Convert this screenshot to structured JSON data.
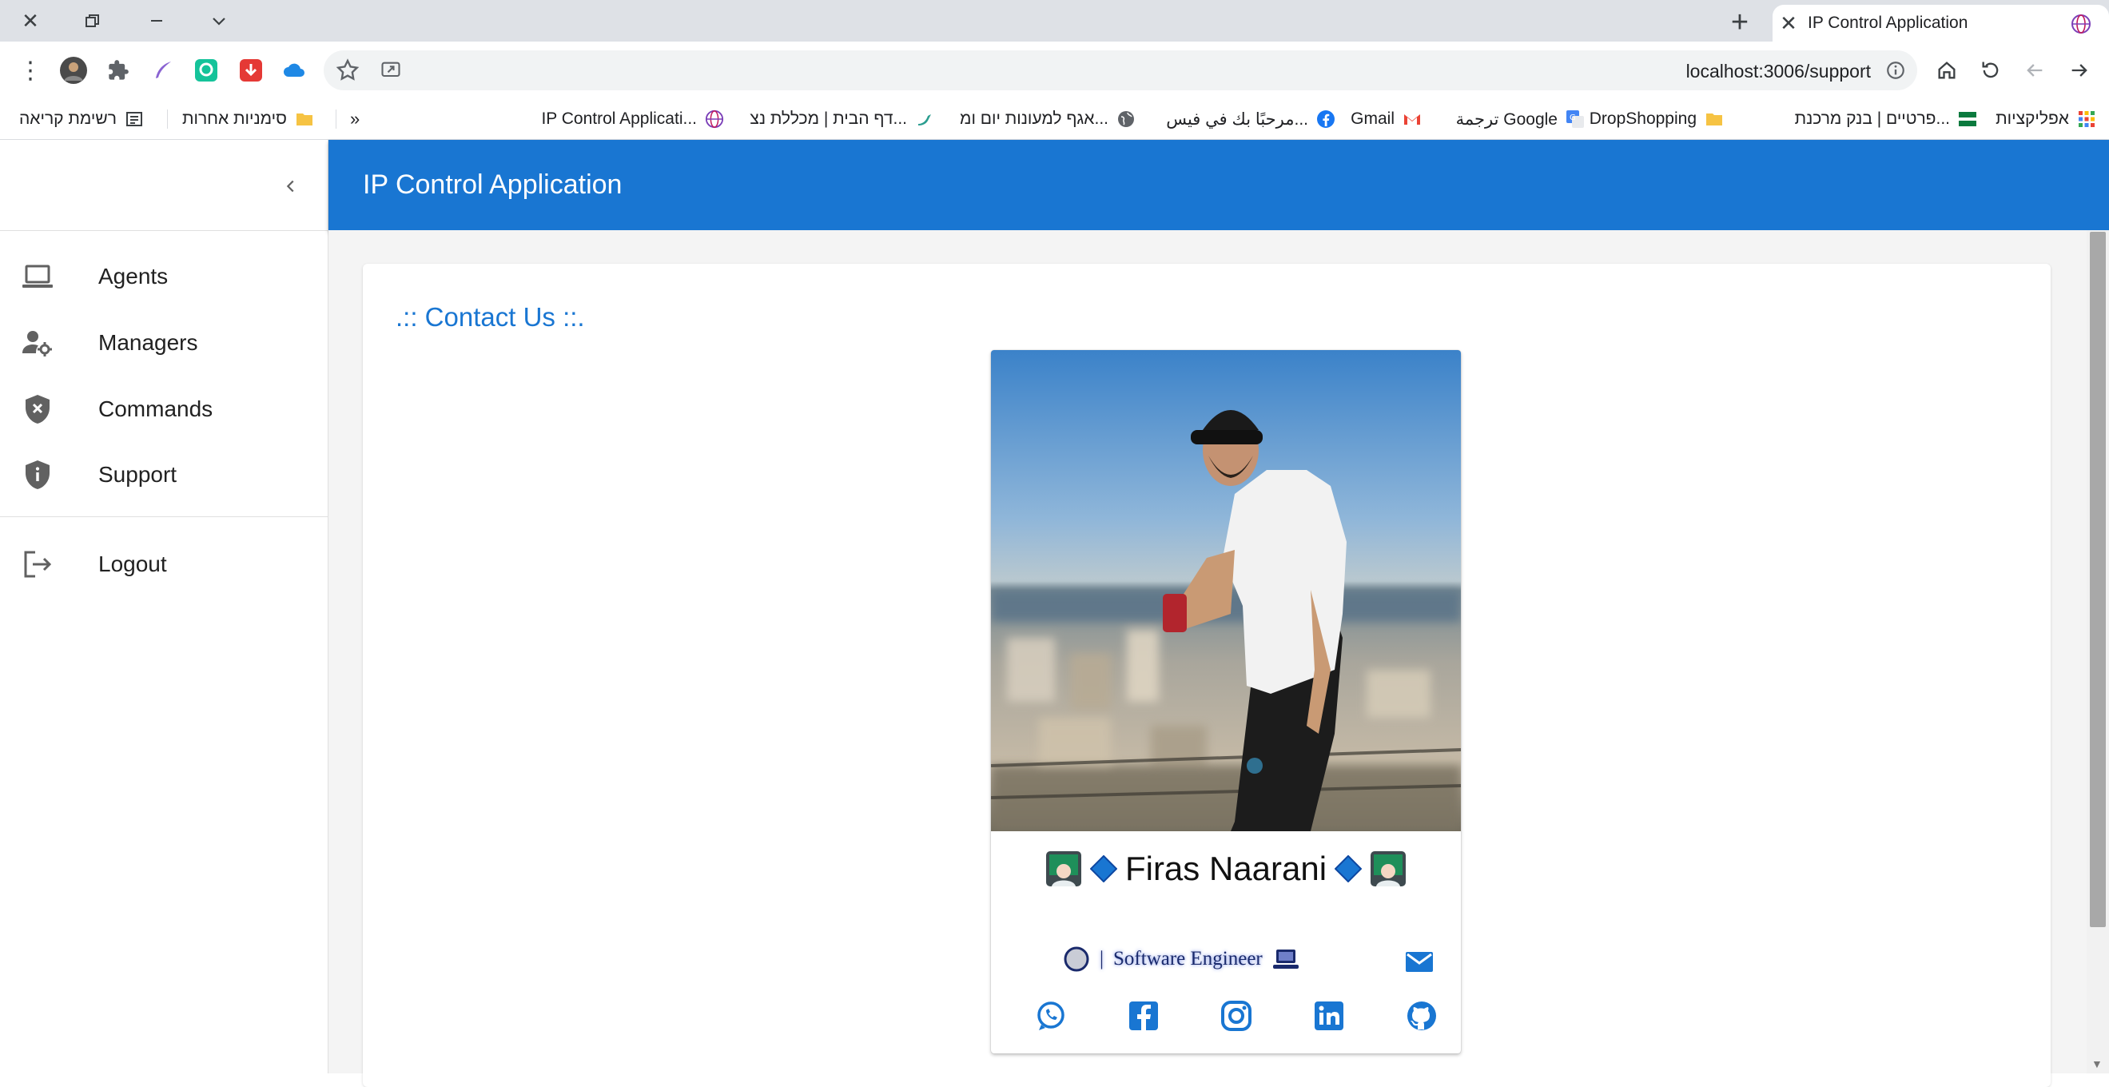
{
  "browser": {
    "tab_title": "IP Control Application",
    "new_tab_label": "+",
    "url": "localhost:3006/support",
    "bookmarks": [
      {
        "label": "אפליקציות",
        "color": "#ea4335"
      },
      {
        "label": "פרטיים | בנק מרכנת...",
        "color": "#0b7a3e"
      },
      {
        "label": "DropShopping",
        "color": "#f6c343"
      },
      {
        "label": "ترجمة Google",
        "color": "#4285f4"
      },
      {
        "label": "Gmail",
        "color": "#ea4335"
      },
      {
        "label": "مرحبًا بك في فيس...",
        "color": "#1877f2"
      },
      {
        "label": "אגף למעונות יום ומ...",
        "color": "#5f6368"
      },
      {
        "label": "דף הבית | מכללת נצ...",
        "color": "#2a9d8f"
      },
      {
        "label": "IP Control Applicati...",
        "color": "#7b3fb8"
      },
      {
        "label": "»",
        "color": ""
      },
      {
        "label": "סימניות אחרות",
        "color": "#f6c343"
      },
      {
        "label": "רשימת קריאה",
        "color": "#5f6368"
      }
    ]
  },
  "app": {
    "title": "IP Control Application",
    "nav": [
      {
        "label": "Agents",
        "icon": "laptop-icon"
      },
      {
        "label": "Managers",
        "icon": "manage-accounts-icon"
      },
      {
        "label": "Commands",
        "icon": "shield-x-icon"
      },
      {
        "label": "Support",
        "icon": "shield-info-icon"
      }
    ],
    "logout_label": "Logout"
  },
  "contact": {
    "heading": ".:: Contact Us ::.",
    "name": "Firas Naarani",
    "role": "Software Engineer"
  },
  "colors": {
    "primary": "#1976d2",
    "appbar_text": "#ffffff"
  }
}
